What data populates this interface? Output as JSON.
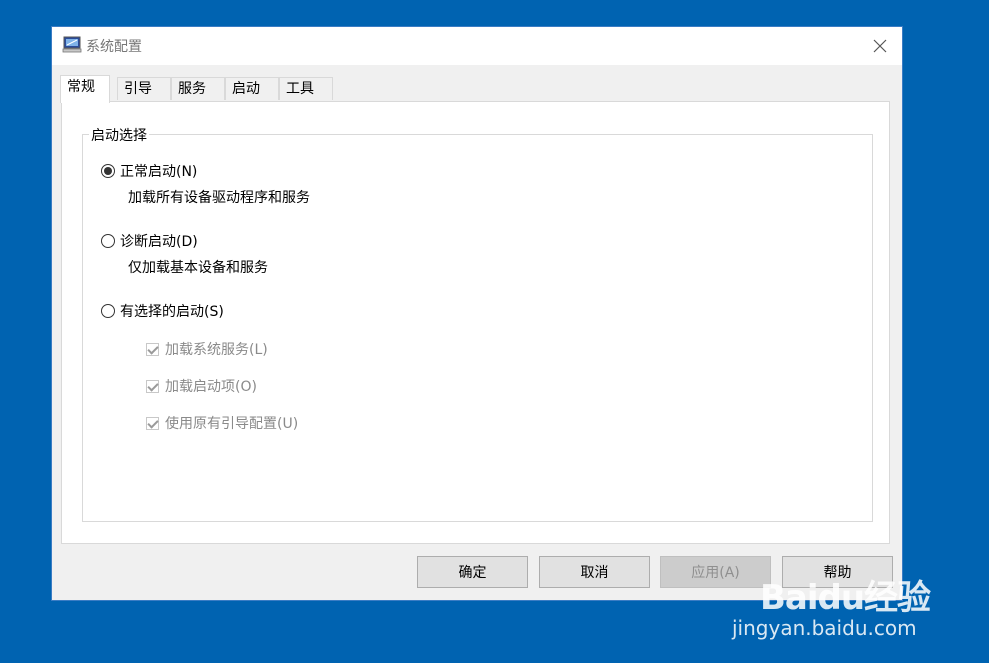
{
  "window": {
    "title": "系统配置",
    "close_glyph": "✕"
  },
  "tabs": [
    {
      "label": "常规",
      "active": true
    },
    {
      "label": "引导",
      "active": false
    },
    {
      "label": "服务",
      "active": false
    },
    {
      "label": "启动",
      "active": false
    },
    {
      "label": "工具",
      "active": false
    }
  ],
  "startup_selection": {
    "legend": "启动选择",
    "options": [
      {
        "label": "正常启动(N)",
        "description": "加载所有设备驱动程序和服务",
        "checked": true
      },
      {
        "label": "诊断启动(D)",
        "description": "仅加载基本设备和服务",
        "checked": false
      },
      {
        "label": "有选择的启动(S)",
        "checked": false
      }
    ],
    "selective_options": [
      {
        "label": "加载系统服务(L)",
        "checked": true,
        "disabled": true
      },
      {
        "label": "加载启动项(O)",
        "checked": true,
        "disabled": true
      },
      {
        "label": "使用原有引导配置(U)",
        "checked": true,
        "disabled": true
      }
    ]
  },
  "buttons": {
    "ok": "确定",
    "cancel": "取消",
    "apply": "应用(A)",
    "help": "帮助"
  },
  "watermark": {
    "logo": "Baidu经验",
    "url": "jingyan.baidu.com"
  },
  "colors": {
    "desktop": "#0063b1",
    "window_bg": "#f0f0f0"
  }
}
